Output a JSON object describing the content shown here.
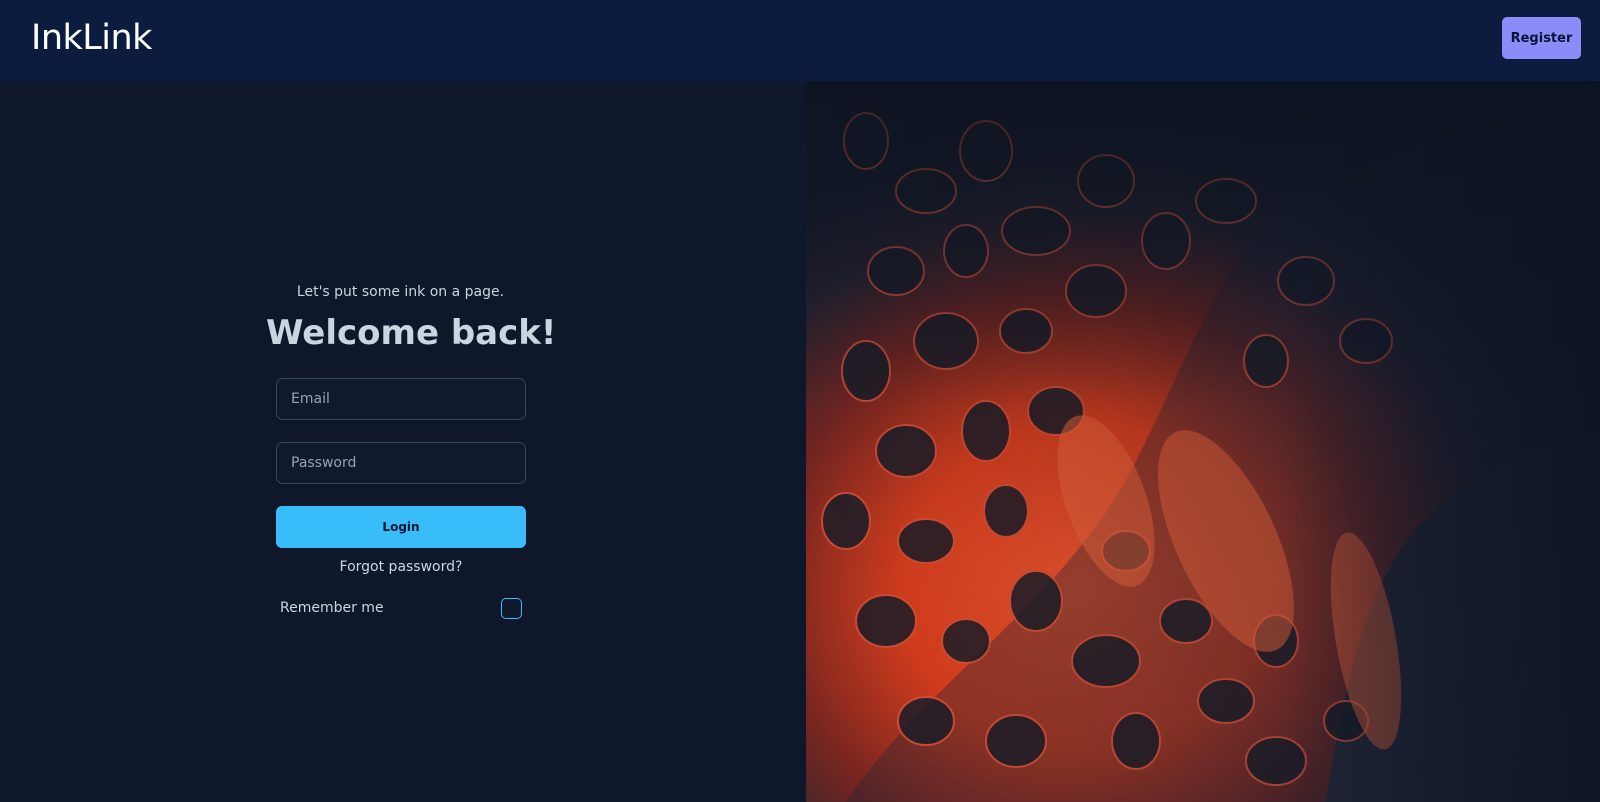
{
  "header": {
    "brand": "InkLink",
    "register_label": "Register"
  },
  "login": {
    "tagline": "Let's put some ink on a page.",
    "heading": "Welcome back!",
    "email_placeholder": "Email",
    "password_placeholder": "Password",
    "login_label": "Login",
    "forgot_label": "Forgot password?",
    "remember_label": "Remember me",
    "remember_checked": false
  },
  "colors": {
    "header_bg": "#0b1c3f",
    "page_bg": "#0f172a",
    "register_accent": "#8b8cf8",
    "login_accent": "#38bdf8"
  },
  "decor": {
    "hero_image": "abstract-red-ink-art"
  }
}
